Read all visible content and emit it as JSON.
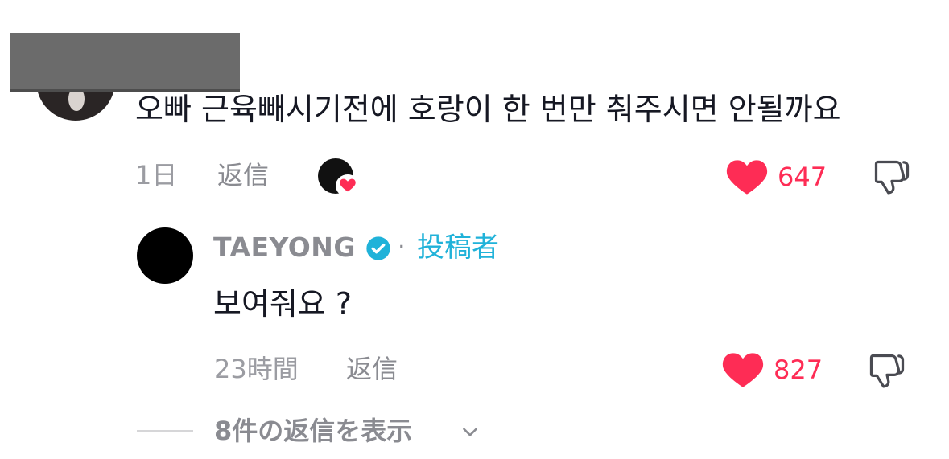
{
  "comment": {
    "text": "오빠 근육빼시기전에 호랑이 한 번만 춰주시면 안될까요",
    "time": "1日",
    "reply_label": "返信",
    "like_count": "647"
  },
  "reply": {
    "author": "TAEYONG",
    "separator": "·",
    "badge": "投稿者",
    "text": "보여줘요 ?",
    "time": "23時間",
    "reply_label": "返信",
    "like_count": "827"
  },
  "view_replies": {
    "label": "8件の返信を表示"
  },
  "colors": {
    "accent_like": "#fe2c55",
    "verified": "#20b2d9",
    "meta_gray": "#8a8b91"
  },
  "icons": {
    "like": "heart-icon",
    "dislike": "thumbs-down-icon",
    "verified": "verified-check-icon",
    "expand": "chevron-down-icon",
    "creator_liked": "creator-liked-icon"
  }
}
